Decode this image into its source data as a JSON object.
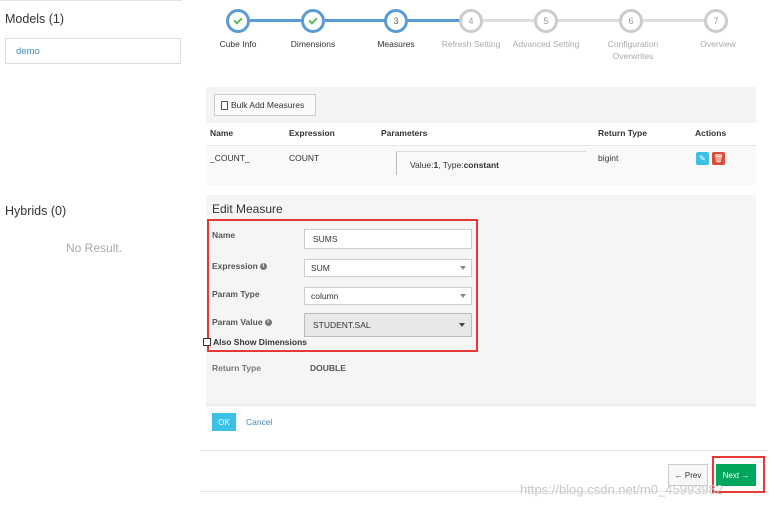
{
  "left": {
    "models_title": "Models (1)",
    "model_item": "demo",
    "hybrids_title": "Hybrids (0)",
    "no_result": "No Result."
  },
  "wizard": {
    "steps": [
      {
        "number": "1",
        "label": "Cube Info",
        "state": "done"
      },
      {
        "number": "2",
        "label": "Dimensions",
        "state": "done"
      },
      {
        "number": "3",
        "label": "Measures",
        "state": "current"
      },
      {
        "number": "4",
        "label": "Refresh Setting",
        "state": "todo"
      },
      {
        "number": "5",
        "label": "Advanced Setting",
        "state": "todo"
      },
      {
        "number": "6",
        "label": "Configuration Overwrites",
        "state": "todo"
      },
      {
        "number": "7",
        "label": "Overview",
        "state": "todo"
      }
    ]
  },
  "measures": {
    "bulk_add_label": "Bulk Add Measures",
    "headers": {
      "name": "Name",
      "expression": "Expression",
      "parameters": "Parameters",
      "return_type": "Return Type",
      "actions": "Actions"
    },
    "row": {
      "name": "_COUNT_",
      "expression": "COUNT",
      "param_prefix": "Value:",
      "param_value": "1",
      "param_mid": ", Type:",
      "param_type": "constant",
      "return_type": "bigint"
    }
  },
  "edit": {
    "title": "Edit Measure",
    "name_label": "Name",
    "name_value": "SUMS",
    "expression_label": "Expression",
    "expression_value": "SUM",
    "param_type_label": "Param Type",
    "param_type_value": "column",
    "param_value_label": "Param Value",
    "param_value_value": "STUDENT.SAL",
    "also_show_label": "Also Show Dimensions",
    "return_type_label": "Return Type",
    "return_type_value": "DOUBLE",
    "ok_label": "OK",
    "cancel_label": "Cancel"
  },
  "footer": {
    "prev_label": "Prev",
    "next_label": "Next"
  },
  "watermark": "https://blog.csdn.net/m0_45993982",
  "colors": {
    "accent": "#3c8dbc",
    "step": "#5b9bd5",
    "check": "#5cb85c",
    "ok": "#3cc1e6",
    "next": "#00a65a",
    "highlight": "#e53935"
  },
  "icons": [
    "check-icon",
    "document-icon",
    "edit-icon",
    "trash-icon",
    "info-icon",
    "caret-down-icon",
    "arrow-left-icon",
    "arrow-right-icon"
  ]
}
